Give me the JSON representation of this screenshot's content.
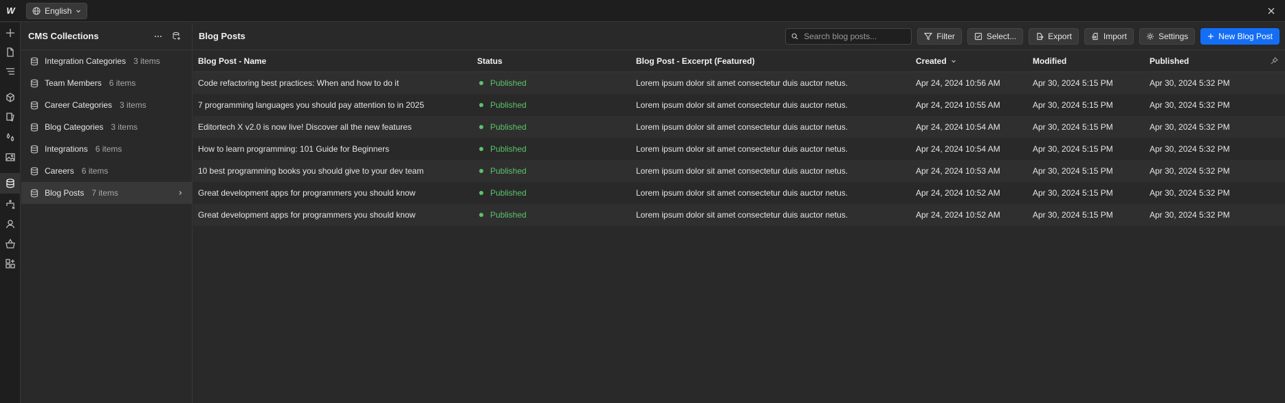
{
  "topbar": {
    "logo": "W",
    "language": "English"
  },
  "collections": {
    "title": "CMS Collections",
    "items": [
      {
        "label": "Integration Categories",
        "count": "3 items"
      },
      {
        "label": "Team Members",
        "count": "6 items"
      },
      {
        "label": "Career Categories",
        "count": "3 items"
      },
      {
        "label": "Blog Categories",
        "count": "3 items"
      },
      {
        "label": "Integrations",
        "count": "6 items"
      },
      {
        "label": "Careers",
        "count": "6 items"
      },
      {
        "label": "Blog Posts",
        "count": "7 items"
      }
    ]
  },
  "main": {
    "title": "Blog Posts",
    "search_placeholder": "Search blog posts...",
    "buttons": {
      "filter": "Filter",
      "select": "Select...",
      "export": "Export",
      "import": "Import",
      "settings": "Settings",
      "new": "New Blog Post"
    }
  },
  "table": {
    "columns": {
      "name": "Blog Post - Name",
      "status": "Status",
      "excerpt": "Blog Post - Excerpt (Featured)",
      "created": "Created",
      "modified": "Modified",
      "published": "Published"
    },
    "rows": [
      {
        "name": "Code refactoring best practices: When and how to do it",
        "status": "Published",
        "excerpt": "Lorem ipsum dolor sit amet consectetur duis auctor netus.",
        "created": "Apr 24, 2024 10:56 AM",
        "modified": "Apr 30, 2024 5:15 PM",
        "published": "Apr 30, 2024 5:32 PM"
      },
      {
        "name": "7 programming languages you should pay attention to in 2025",
        "status": "Published",
        "excerpt": "Lorem ipsum dolor sit amet consectetur duis auctor netus.",
        "created": "Apr 24, 2024 10:55 AM",
        "modified": "Apr 30, 2024 5:15 PM",
        "published": "Apr 30, 2024 5:32 PM"
      },
      {
        "name": "Editortech X v2.0 is now live! Discover all the new features",
        "status": "Published",
        "excerpt": "Lorem ipsum dolor sit amet consectetur duis auctor netus.",
        "created": "Apr 24, 2024 10:54 AM",
        "modified": "Apr 30, 2024 5:15 PM",
        "published": "Apr 30, 2024 5:32 PM"
      },
      {
        "name": "How to learn programming: 101 Guide for Beginners",
        "status": "Published",
        "excerpt": "Lorem ipsum dolor sit amet consectetur duis auctor netus.",
        "created": "Apr 24, 2024 10:54 AM",
        "modified": "Apr 30, 2024 5:15 PM",
        "published": "Apr 30, 2024 5:32 PM"
      },
      {
        "name": "10 best programming books you should give to your dev team",
        "status": "Published",
        "excerpt": "Lorem ipsum dolor sit amet consectetur duis auctor netus.",
        "created": "Apr 24, 2024 10:53 AM",
        "modified": "Apr 30, 2024 5:15 PM",
        "published": "Apr 30, 2024 5:32 PM"
      },
      {
        "name": "Great development apps for programmers you should know",
        "status": "Published",
        "excerpt": "Lorem ipsum dolor sit amet consectetur duis auctor netus.",
        "created": "Apr 24, 2024 10:52 AM",
        "modified": "Apr 30, 2024 5:15 PM",
        "published": "Apr 30, 2024 5:32 PM"
      },
      {
        "name": "Great development apps for programmers you should know",
        "status": "Published",
        "excerpt": "Lorem ipsum dolor sit amet consectetur duis auctor netus.",
        "created": "Apr 24, 2024 10:52 AM",
        "modified": "Apr 30, 2024 5:15 PM",
        "published": "Apr 30, 2024 5:32 PM"
      }
    ]
  },
  "colors": {
    "accent": "#146ef5",
    "status_published": "#5ac46a"
  }
}
